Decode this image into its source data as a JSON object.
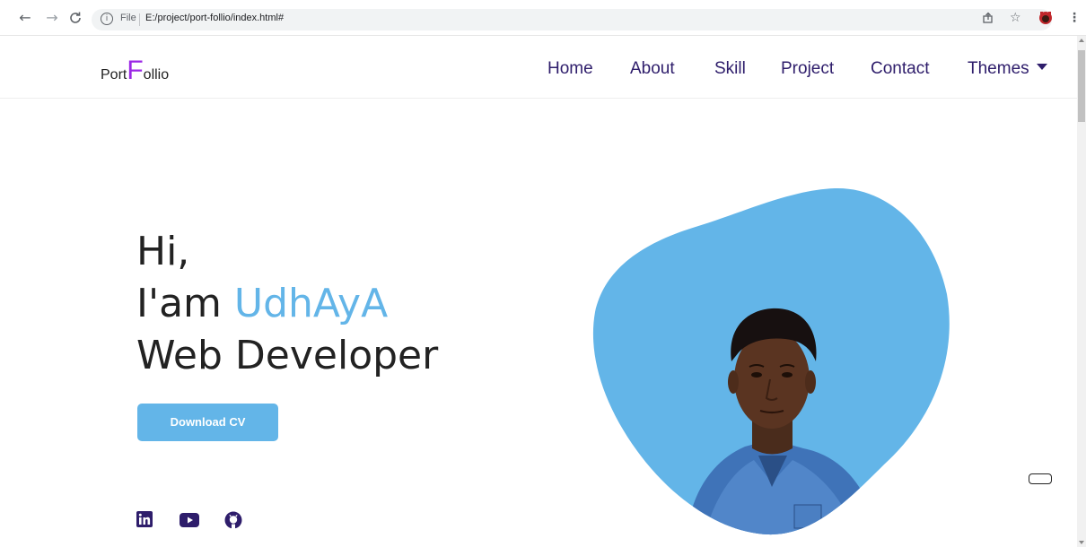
{
  "browser": {
    "scheme_label": "File",
    "url": "E:/project/port-follio/index.html#",
    "info_glyph": "i",
    "icons": [
      "back-arrow-icon",
      "forward-arrow-icon",
      "reload-icon",
      "share-icon",
      "star-icon",
      "extension-avatar-icon",
      "more-vert-icon"
    ]
  },
  "logo": {
    "pre": "Port",
    "big": "F",
    "post": "ollio",
    "accent_color": "#9b27e6"
  },
  "nav": {
    "items": [
      {
        "label": "Home"
      },
      {
        "label": "About"
      },
      {
        "label": "Skill"
      },
      {
        "label": "Project"
      },
      {
        "label": "Contact"
      },
      {
        "label": "Themes"
      }
    ],
    "color": "#2e1d6b"
  },
  "hero": {
    "line1": "Hi,",
    "line2_prefix": "I'am ",
    "name": "UdhAyA",
    "line3": "Web Developer",
    "name_color": "#63b5e8"
  },
  "cv_button": {
    "label": "Download CV",
    "color": "#63b5e8"
  },
  "socials": [
    "linkedin-icon",
    "youtube-icon",
    "github-icon"
  ],
  "blob_color": "#63b5e8"
}
